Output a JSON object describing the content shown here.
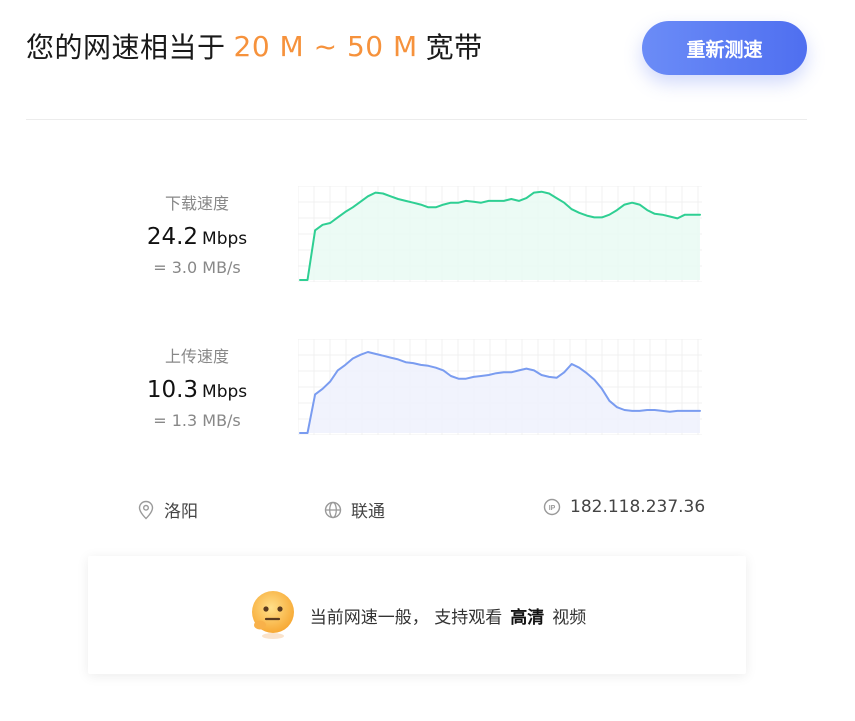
{
  "header": {
    "title_prefix": "您的网速相当于",
    "range": "20 M ~ 50 M",
    "title_suffix": "宽带",
    "retest_label": "重新测速"
  },
  "download": {
    "label": "下载速度",
    "value": "24.2",
    "unit": "Mbps",
    "sub": "= 3.0 MB/s",
    "line_color": "#2fcf93",
    "fill_color": "#e9faf3",
    "samples": [
      0,
      0,
      54,
      60,
      62,
      68,
      74,
      79,
      85,
      91,
      95,
      94,
      91,
      88,
      86,
      84,
      82,
      79,
      79,
      82,
      84,
      84,
      86,
      85,
      84,
      86,
      86,
      86,
      88,
      86,
      89,
      95,
      96,
      94,
      89,
      84,
      77,
      73,
      70,
      68,
      68,
      71,
      76,
      82,
      84,
      82,
      76,
      72,
      71,
      69,
      67,
      71,
      71,
      71
    ]
  },
  "upload": {
    "label": "上传速度",
    "value": "10.3",
    "unit": "Mbps",
    "sub": "= 1.3 MB/s",
    "line_color": "#7a9cf0",
    "fill_color": "#eef1fd",
    "samples": [
      0,
      0,
      42,
      48,
      56,
      68,
      74,
      81,
      85,
      88,
      86,
      84,
      82,
      80,
      77,
      76,
      74,
      73,
      71,
      68,
      62,
      59,
      59,
      61,
      62,
      63,
      65,
      66,
      66,
      68,
      70,
      68,
      63,
      61,
      60,
      66,
      75,
      71,
      65,
      58,
      48,
      35,
      28,
      25,
      24,
      24,
      25,
      25,
      24,
      23,
      24,
      24,
      24,
      24
    ]
  },
  "info": {
    "city": "洛阳",
    "isp": "联通",
    "ip": "182.118.237.36"
  },
  "verdict": {
    "prefix": "当前网速一般，  支持观看",
    "quality": "高清",
    "suffix": "视频"
  }
}
